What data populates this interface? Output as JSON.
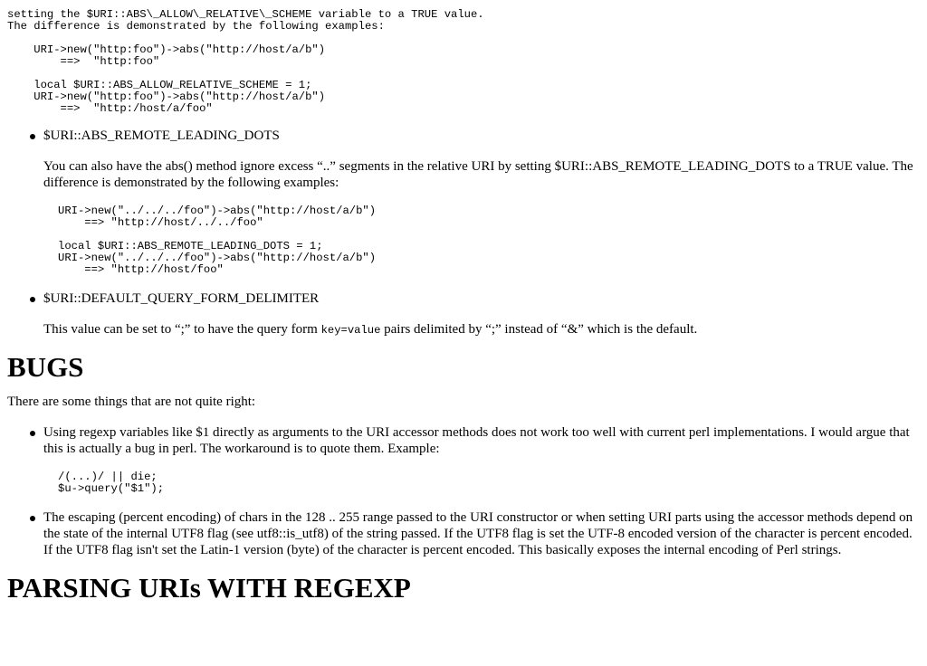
{
  "top_block": {
    "intro": "setting the $URI::ABS\\_ALLOW\\_RELATIVE\\_SCHEME variable to a TRUE value.\nThe difference is demonstrated by the following examples:\n\n    URI->new(\"http:foo\")->abs(\"http://host/a/b\")\n        ==>  \"http:foo\"\n\n    local $URI::ABS_ALLOW_RELATIVE_SCHEME = 1;\n    URI->new(\"http:foo\")->abs(\"http://host/a/b\")\n        ==>  \"http:/host/a/foo\""
  },
  "options": [
    {
      "title": "$URI::ABS_REMOTE_LEADING_DOTS",
      "text": "You can also have the abs() method ignore excess “..” segments in the relative URI by setting $URI::ABS_REMOTE_LEADING_DOTS to a TRUE value. The difference is demonstrated by the following examples:",
      "code": "URI->new(\"../../../foo\")->abs(\"http://host/a/b\")\n    ==> \"http://host/../../foo\"\n\nlocal $URI::ABS_REMOTE_LEADING_DOTS = 1;\nURI->new(\"../../../foo\")->abs(\"http://host/a/b\")\n    ==> \"http://host/foo\""
    },
    {
      "title": "$URI::DEFAULT_QUERY_FORM_DELIMITER",
      "text_before": "This value can be set to “;” to have the query form ",
      "code_inline": "key=value",
      "text_after": " pairs delimited by “;” instead of “&” which is the default."
    }
  ],
  "bugs": {
    "heading": "BUGS",
    "intro": "There are some things that are not quite right:",
    "items": [
      {
        "text": "Using regexp variables like $1 directly as arguments to the URI accessor methods does not work too well with current perl implementations. I would argue that this is actually a bug in perl. The workaround is to quote them. Example:",
        "code": "/(...)/ || die;\n$u->query(\"$1\");"
      },
      {
        "text": "The escaping (percent encoding) of chars in the 128 .. 255 range passed to the URI constructor or when setting URI parts using the accessor methods depend on the state of the internal UTF8 flag (see utf8::is_utf8) of the string passed. If the UTF8 flag is set the UTF-8 encoded version of the character is percent encoded. If the UTF8 flag isn't set the Latin-1 version (byte) of the character is percent encoded. This basically exposes the internal encoding of Perl strings."
      }
    ]
  },
  "parsing": {
    "heading": "PARSING URIs WITH REGEXP"
  }
}
